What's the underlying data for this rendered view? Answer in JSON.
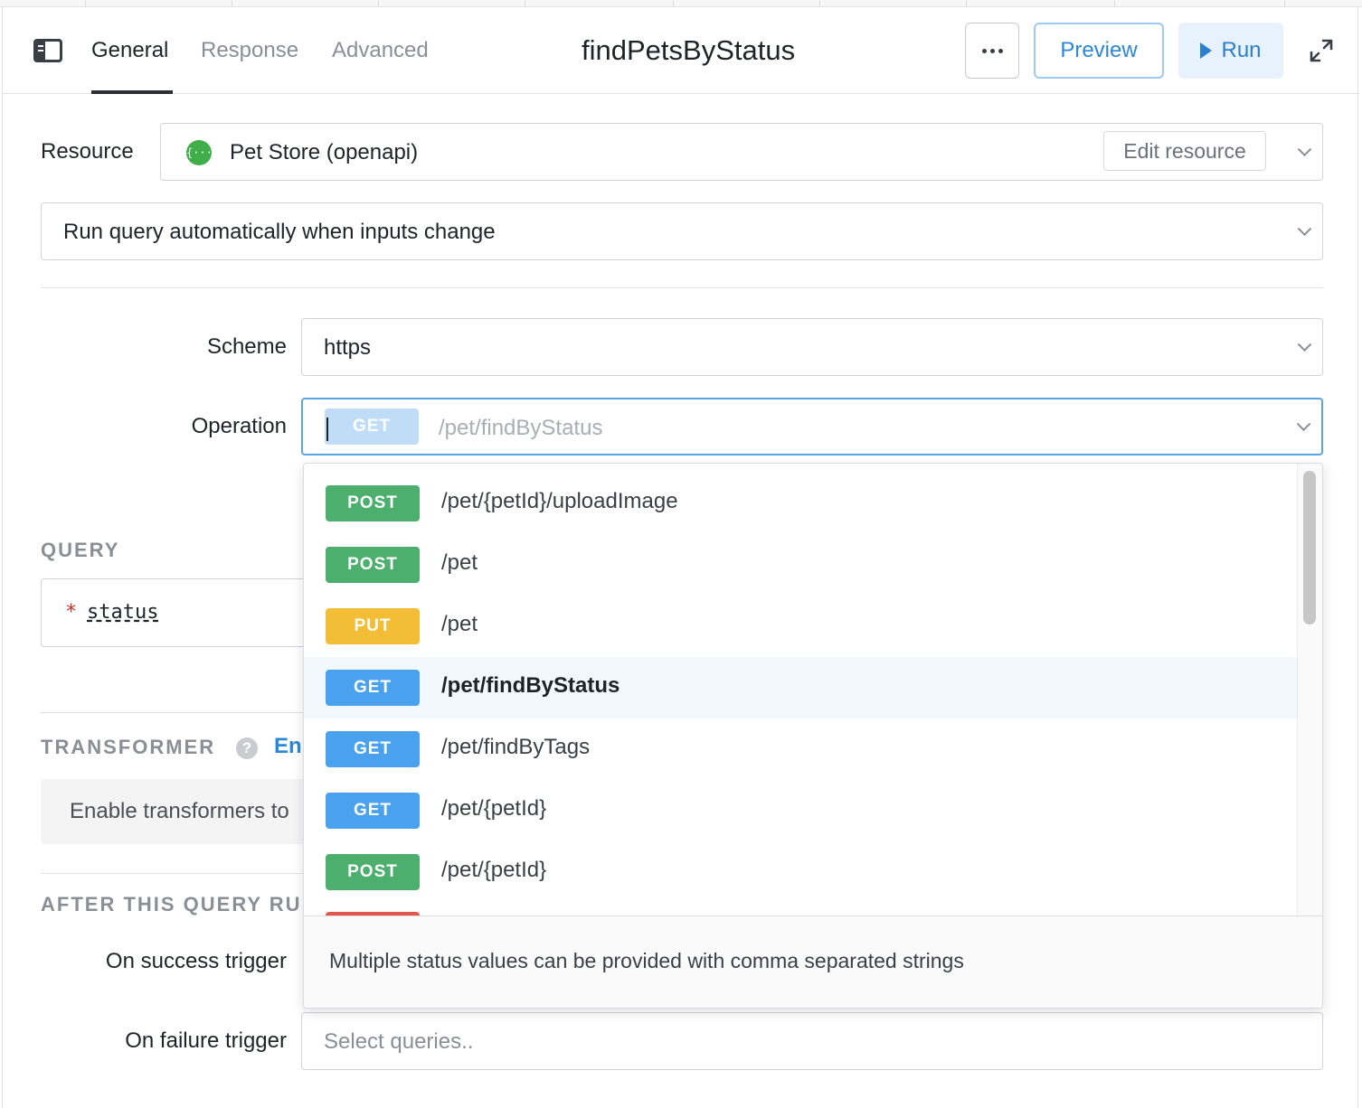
{
  "header": {
    "tabs": [
      {
        "label": "General",
        "active": true
      },
      {
        "label": "Response",
        "active": false
      },
      {
        "label": "Advanced",
        "active": false
      }
    ],
    "title": "findPetsByStatus",
    "preview_label": "Preview",
    "run_label": "Run"
  },
  "resource": {
    "label": "Resource",
    "icon_text": "{···}",
    "value": "Pet Store (openapi)",
    "edit_label": "Edit resource"
  },
  "run_mode": {
    "value": "Run query automatically when inputs change"
  },
  "scheme": {
    "label": "Scheme",
    "value": "https"
  },
  "operation": {
    "label": "Operation",
    "method": "GET",
    "path_placeholder": "/pet/findByStatus",
    "options": [
      {
        "method": "POST",
        "path": "/pet/{petId}/uploadImage"
      },
      {
        "method": "POST",
        "path": "/pet"
      },
      {
        "method": "PUT",
        "path": "/pet"
      },
      {
        "method": "GET",
        "path": "/pet/findByStatus",
        "selected": true
      },
      {
        "method": "GET",
        "path": "/pet/findByTags"
      },
      {
        "method": "GET",
        "path": "/pet/{petId}"
      },
      {
        "method": "POST",
        "path": "/pet/{petId}"
      }
    ],
    "footer_hint": "Multiple status values can be provided with comma separated strings"
  },
  "query": {
    "heading": "QUERY",
    "param_required_mark": "*",
    "param_name": "status"
  },
  "transformer": {
    "heading": "TRANSFORMER",
    "enable_link": "En",
    "help_glyph": "?",
    "hint_text": "Enable transformers to"
  },
  "after_query": {
    "heading": "AFTER THIS QUERY RU",
    "on_success_label": "On success trigger",
    "on_failure_label": "On failure trigger",
    "on_failure_placeholder": "Select queries.."
  },
  "colors": {
    "post": "#4caf6e",
    "put": "#f3bd36",
    "get": "#4aa2ee",
    "delete": "#e2574c",
    "accent": "#2b88d8"
  }
}
